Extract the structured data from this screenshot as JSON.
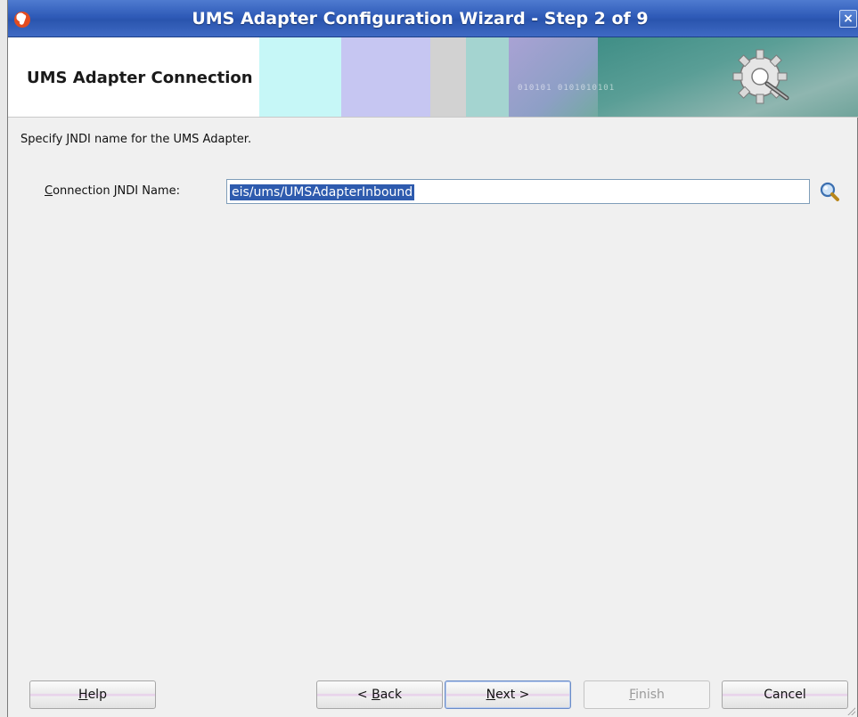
{
  "window": {
    "title": "UMS Adapter Configuration Wizard - Step 2 of 9",
    "close_glyph": "×"
  },
  "banner": {
    "heading": "UMS Adapter Connection",
    "decor_binary": "010101 0101010101"
  },
  "main": {
    "instruction": "Specify JNDI name for the UMS Adapter.",
    "jndi_field": {
      "label_mnemonic": "C",
      "label_rest": "onnection JNDI Name:",
      "value": "eis/ums/UMSAdapterInbound",
      "selected": true
    }
  },
  "buttons": {
    "help": {
      "mnemonic": "H",
      "rest": "elp"
    },
    "back": {
      "prefix": "< ",
      "mnemonic": "B",
      "rest": "ack"
    },
    "next": {
      "mnemonic": "N",
      "rest": "ext >"
    },
    "finish": {
      "mnemonic": "F",
      "rest": "inish",
      "enabled": false
    },
    "cancel": {
      "label": "Cancel"
    }
  },
  "icons": {
    "app": "oracle-app-icon",
    "close": "close-icon",
    "search": "search-icon",
    "gear": "gear-icon"
  },
  "colors": {
    "titlebar": "#2f5bb8",
    "selection": "#2e5bae",
    "background": "#f0f0f0"
  }
}
